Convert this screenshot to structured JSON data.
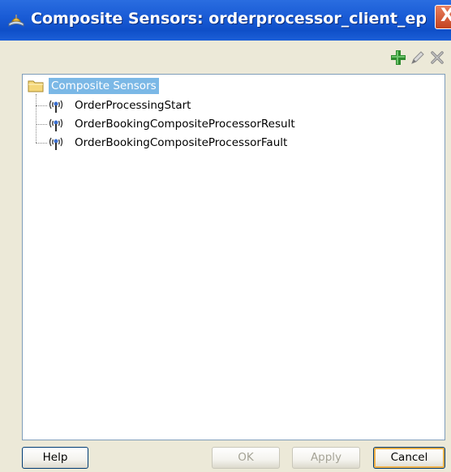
{
  "window": {
    "title": "Composite Sensors: orderprocessor_client_ep",
    "close_label": "X"
  },
  "toolbar": {
    "add_icon": "plus-icon",
    "edit_icon": "pencil-icon",
    "delete_icon": "delete-x-icon"
  },
  "tree": {
    "root_label": "Composite Sensors",
    "items": [
      {
        "label": "OrderProcessingStart",
        "icon": "sensor-icon"
      },
      {
        "label": "OrderBookingCompositeProcessorResult",
        "icon": "sensor-icon"
      },
      {
        "label": "OrderBookingCompositeProcessorFault",
        "icon": "sensor-icon"
      }
    ]
  },
  "buttons": {
    "help": "Help",
    "ok": "OK",
    "apply": "Apply",
    "cancel": "Cancel"
  },
  "colors": {
    "titlebar": "#1a5cd6",
    "selection": "#7bb8e6",
    "add_icon": "#2e8b2e"
  }
}
